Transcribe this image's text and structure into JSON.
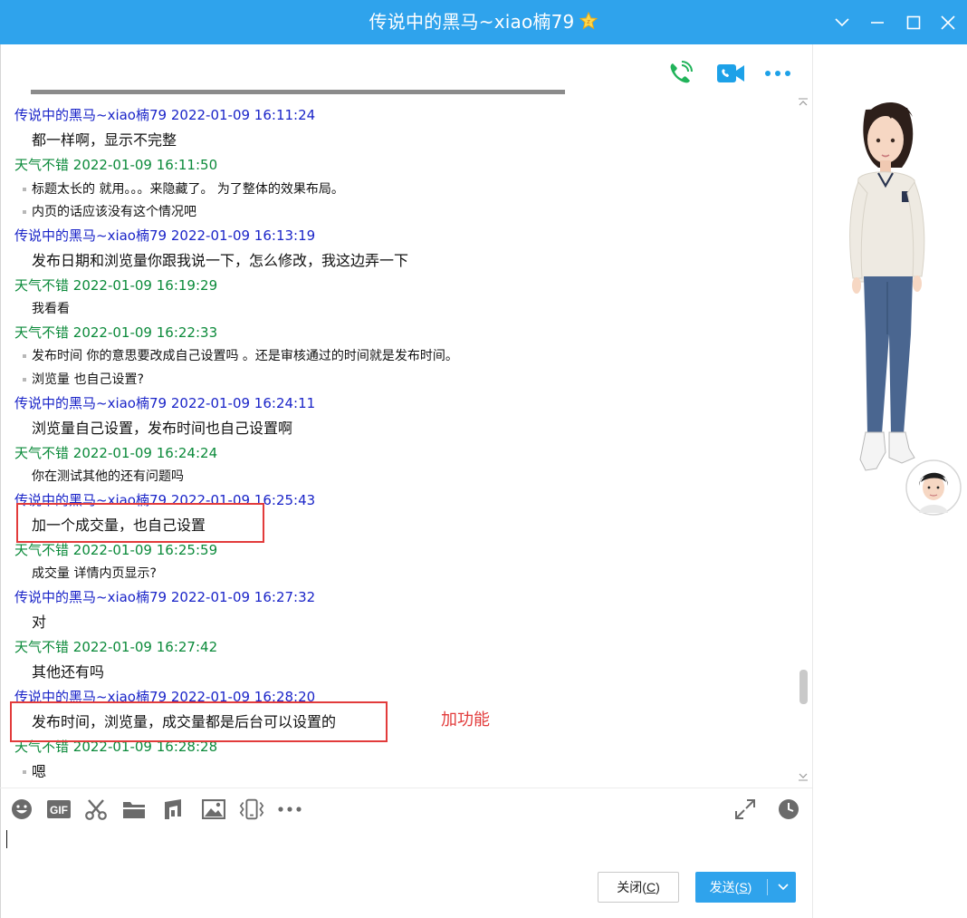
{
  "window": {
    "title": "传说中的黑马~xiao楠79",
    "title_bg": "#2fa3ec"
  },
  "toolbar_top": {
    "icons": [
      "phone-call-icon",
      "video-call-icon",
      "more-icon"
    ]
  },
  "chat": {
    "me_color": "#1a24c8",
    "other_color": "#0b8a3a",
    "messages": [
      {
        "sender": "传说中的黑马~xiao楠79",
        "time": "2022-01-09 16:11:24",
        "lines": [
          "都一样啊，显示不完整"
        ]
      },
      {
        "sender": "天气不错",
        "time": "2022-01-09 16:11:50",
        "lines": [
          "标题太长的 就用。。。来隐藏了。 为了整体的效果布局。",
          "内页的话应该没有这个情况吧"
        ]
      },
      {
        "sender": "传说中的黑马~xiao楠79",
        "time": "2022-01-09 16:13:19",
        "lines": [
          "发布日期和浏览量你跟我说一下，怎么修改，我这边弄一下"
        ]
      },
      {
        "sender": "天气不错",
        "time": "2022-01-09 16:19:29",
        "lines": [
          "我看看"
        ]
      },
      {
        "sender": "天气不错",
        "time": "2022-01-09 16:22:33",
        "lines": [
          "发布时间 你的意思要改成自己设置吗 。还是审核通过的时间就是发布时间。",
          "浏览量 也自己设置?"
        ]
      },
      {
        "sender": "传说中的黑马~xiao楠79",
        "time": "2022-01-09 16:24:11",
        "lines": [
          "浏览量自己设置，发布时间也自己设置啊"
        ]
      },
      {
        "sender": "天气不错",
        "time": "2022-01-09 16:24:24",
        "lines": [
          "你在测试其他的还有问题吗"
        ]
      },
      {
        "sender": "传说中的黑马~xiao楠79",
        "time": "2022-01-09 16:25:43",
        "lines": [
          "加一个成交量，也自己设置"
        ]
      },
      {
        "sender": "天气不错",
        "time": "2022-01-09 16:25:59",
        "lines": [
          "成交量 详情内页显示?"
        ]
      },
      {
        "sender": "传说中的黑马~xiao楠79",
        "time": "2022-01-09 16:27:32",
        "lines": [
          "对"
        ]
      },
      {
        "sender": "天气不错",
        "time": "2022-01-09 16:27:42",
        "lines": [
          "其他还有吗"
        ]
      },
      {
        "sender": "传说中的黑马~xiao楠79",
        "time": "2022-01-09 16:28:20",
        "lines": [
          "发布时间，浏览量，成交量都是后台可以设置的"
        ]
      },
      {
        "sender": "天气不错",
        "time": "2022-01-09 16:28:28",
        "lines": [
          "嗯"
        ]
      }
    ]
  },
  "annotation": {
    "text": "加功能",
    "color": "#e23b3b"
  },
  "input_toolbar": {
    "icons": [
      "emoji-icon",
      "gif-icon",
      "scissors-icon",
      "folder-icon",
      "music-icon",
      "image-icon",
      "shake-icon",
      "more-icon",
      "expand-icon",
      "history-clock-icon"
    ]
  },
  "buttons": {
    "close_label": "关闭(",
    "close_key": "C",
    "close_tail": ")",
    "send_label": "发送(",
    "send_key": "S",
    "send_tail": ")"
  }
}
